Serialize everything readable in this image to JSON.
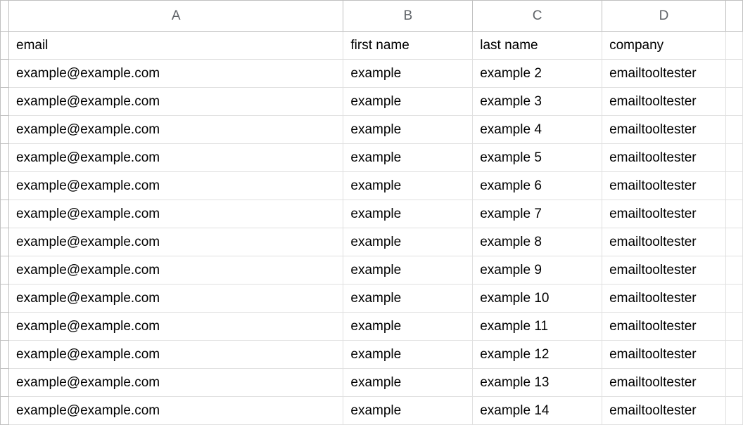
{
  "columns": {
    "a": "A",
    "b": "B",
    "c": "C",
    "d": "D",
    "e": ""
  },
  "headers": {
    "email": "email",
    "first_name": "first name",
    "last_name": "last name",
    "company": "company"
  },
  "rows": [
    {
      "email": "example@example.com",
      "first_name": "example",
      "last_name": "example 2",
      "company": "emailtooltester"
    },
    {
      "email": "example@example.com",
      "first_name": "example",
      "last_name": "example 3",
      "company": "emailtooltester"
    },
    {
      "email": "example@example.com",
      "first_name": "example",
      "last_name": "example 4",
      "company": "emailtooltester"
    },
    {
      "email": "example@example.com",
      "first_name": "example",
      "last_name": "example 5",
      "company": "emailtooltester"
    },
    {
      "email": "example@example.com",
      "first_name": "example",
      "last_name": "example 6",
      "company": "emailtooltester"
    },
    {
      "email": "example@example.com",
      "first_name": "example",
      "last_name": "example 7",
      "company": "emailtooltester"
    },
    {
      "email": "example@example.com",
      "first_name": "example",
      "last_name": "example 8",
      "company": "emailtooltester"
    },
    {
      "email": "example@example.com",
      "first_name": "example",
      "last_name": "example 9",
      "company": "emailtooltester"
    },
    {
      "email": "example@example.com",
      "first_name": "example",
      "last_name": "example 10",
      "company": "emailtooltester"
    },
    {
      "email": "example@example.com",
      "first_name": "example",
      "last_name": "example 11",
      "company": "emailtooltester"
    },
    {
      "email": "example@example.com",
      "first_name": "example",
      "last_name": "example 12",
      "company": "emailtooltester"
    },
    {
      "email": "example@example.com",
      "first_name": "example",
      "last_name": "example 13",
      "company": "emailtooltester"
    },
    {
      "email": "example@example.com",
      "first_name": "example",
      "last_name": "example 14",
      "company": "emailtooltester"
    }
  ]
}
